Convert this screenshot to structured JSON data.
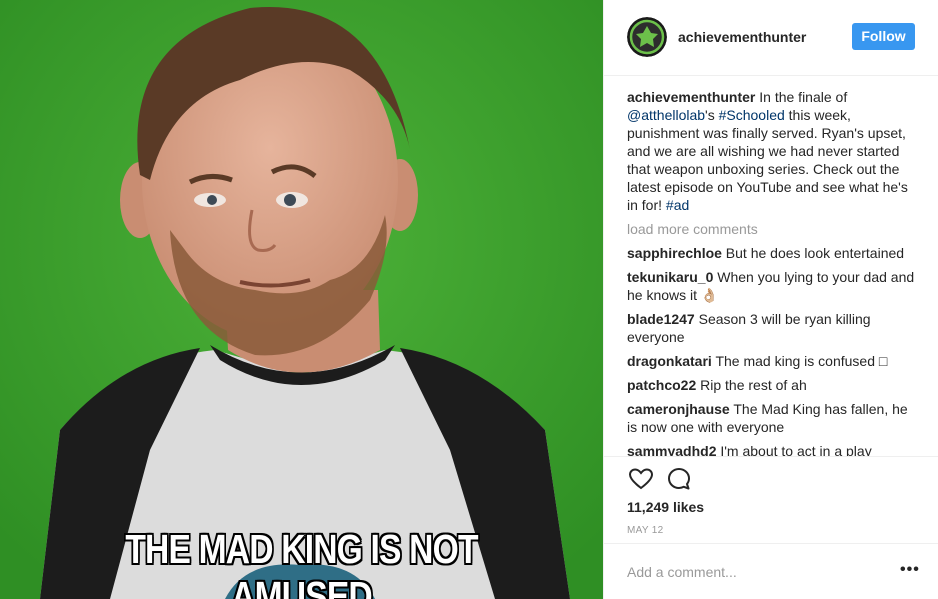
{
  "media": {
    "caption_text": "THE MAD KING IS NOT AMUSED"
  },
  "header": {
    "username": "achievementhunter",
    "follow_label": "Follow"
  },
  "post_caption": {
    "username": "achievementhunter",
    "text_1": " In the finale of ",
    "mention": "@atthellolab",
    "text_2": "'s ",
    "hashtag_1": "#Schooled",
    "text_3": " this week, punishment was finally served. Ryan's upset, and we are all wishing we had never started that weapon unboxing series. Check out the latest episode on YouTube and see what he's in for! ",
    "hashtag_2": "#ad"
  },
  "load_more_label": "load more comments",
  "comments": [
    {
      "user": "sapphirechloe",
      "text": " But he does look entertained"
    },
    {
      "user": "tekunikaru_0",
      "text": " When you lying to your dad and he knows it 👌🏼"
    },
    {
      "user": "blade1247",
      "text": " Season 3 will be ryan killing everyone"
    },
    {
      "user": "dragonkatari",
      "text": " The mad king is confused □"
    },
    {
      "user": "patchco22",
      "text": " Rip the rest of ah"
    },
    {
      "user": "cameronjhause",
      "text": " The Mad King has fallen, he is now one with everyone"
    },
    {
      "user": "sammyadhd2",
      "text": " I'm about to act in a play"
    }
  ],
  "likes": "11,249 likes",
  "date": "MAY 12",
  "add_comment_placeholder": "Add a comment...",
  "more_label": "•••",
  "colors": {
    "follow_button": "#3897f0",
    "link": "#003569",
    "muted": "#999999",
    "greenscreen": "#3aa12c"
  },
  "icons": [
    "heart-icon",
    "comment-icon",
    "more-icon"
  ]
}
